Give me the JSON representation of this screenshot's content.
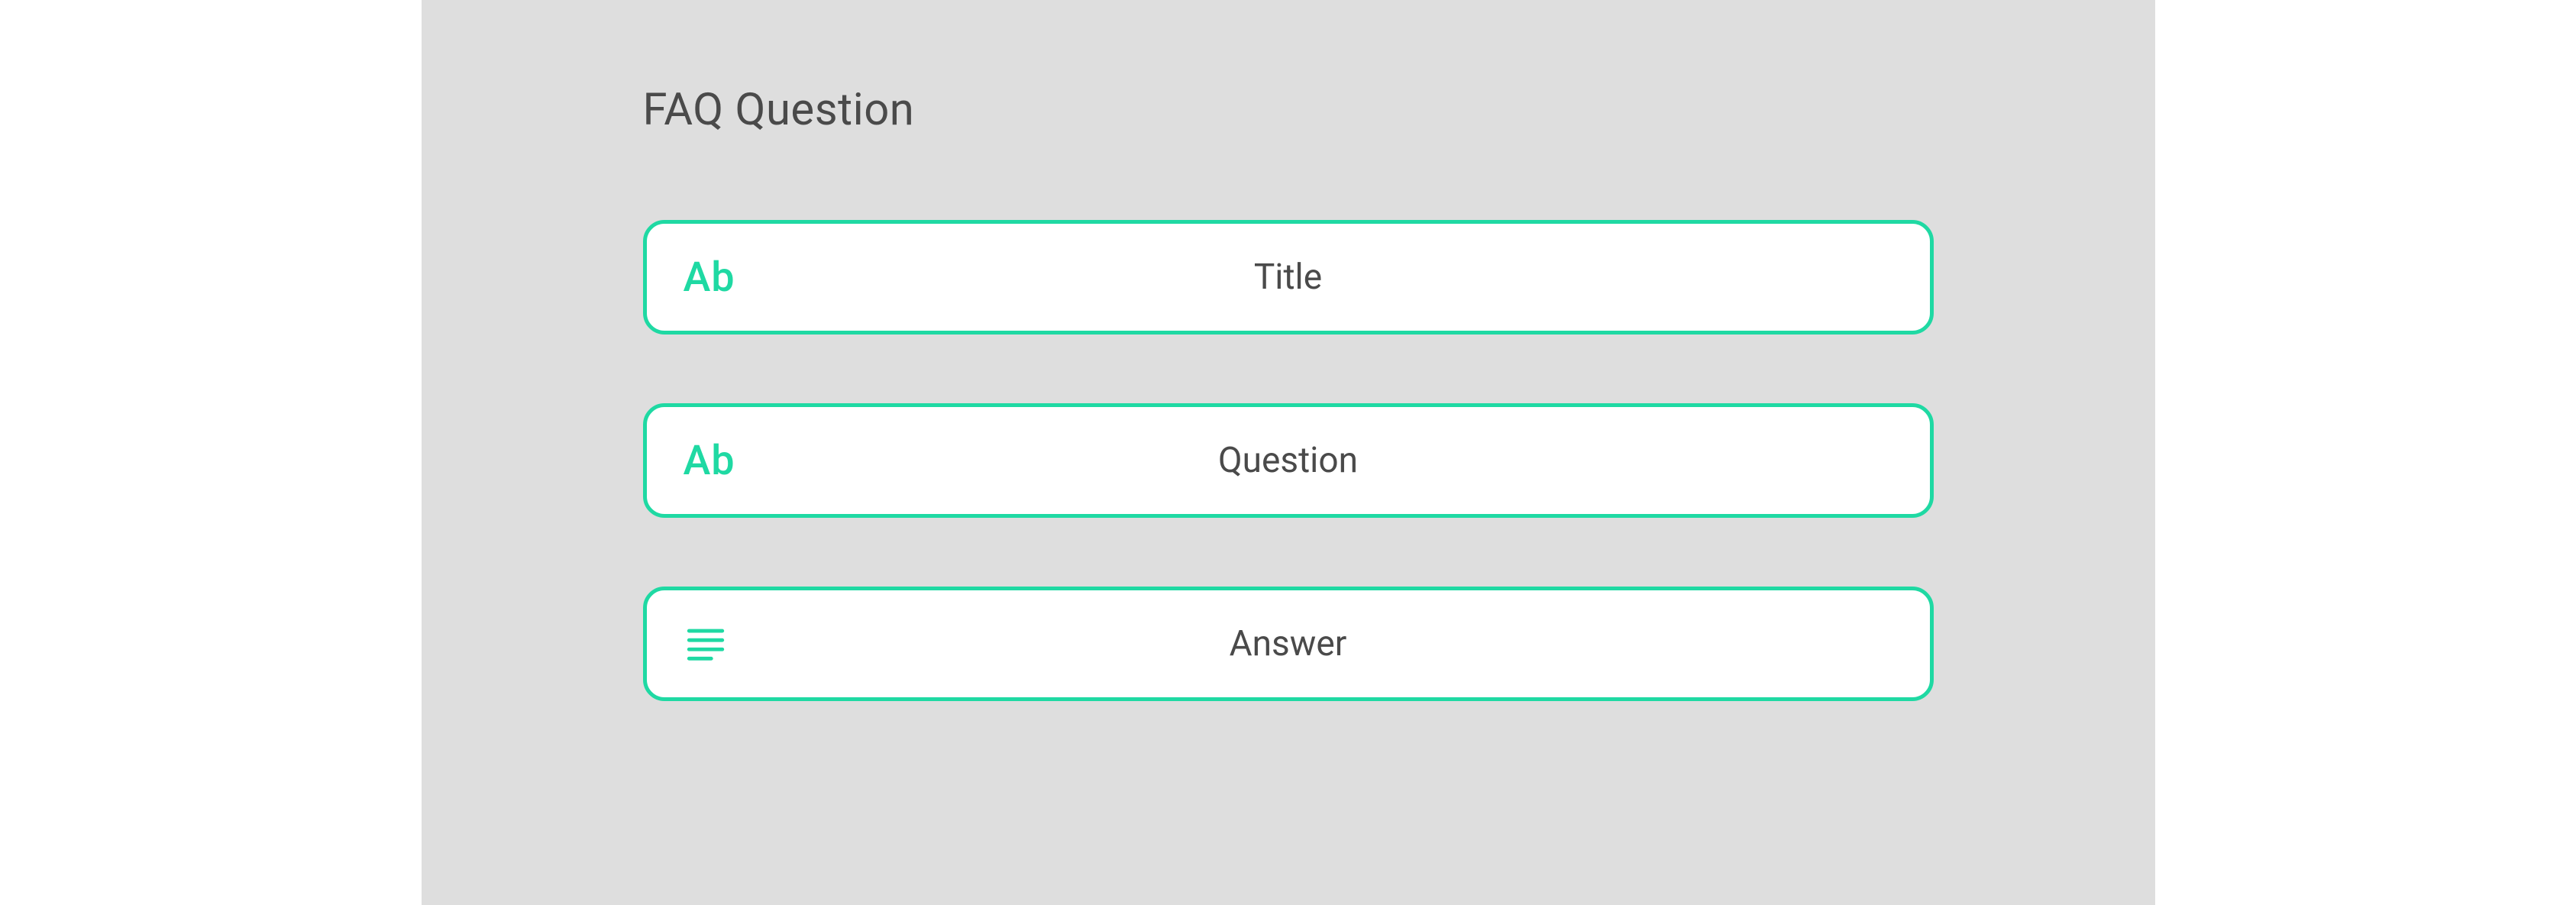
{
  "heading": "FAQ Question",
  "fields": {
    "title": {
      "icon_text": "Ab",
      "label": "Title"
    },
    "question": {
      "icon_text": "Ab",
      "label": "Question"
    },
    "answer": {
      "label": "Answer"
    }
  },
  "colors": {
    "accent": "#1fd9a3",
    "panel_bg": "#dedede",
    "text": "#4a4a4a"
  }
}
